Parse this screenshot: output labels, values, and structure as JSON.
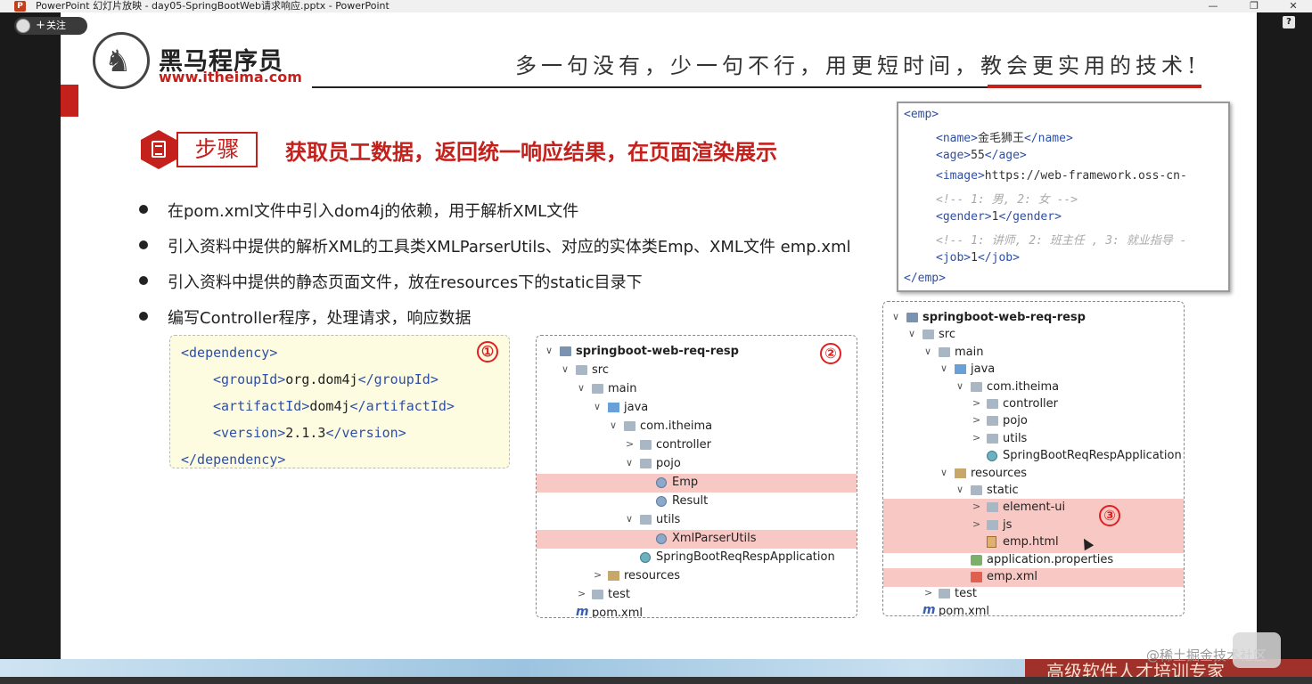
{
  "window": {
    "title": "PowerPoint 幻灯片放映  -  day05-SpringBootWeb请求响应.pptx - PowerPoint",
    "app_icon": "P",
    "min": "—",
    "restore": "❐",
    "close": "✕"
  },
  "follow": {
    "plus": "+",
    "label": "关注"
  },
  "help_icon": "?",
  "header": {
    "brand": "黑马程序员",
    "url": "www.itheima.com",
    "slogan": "多一句没有，少一句不行，用更短时间，教会更实用的技术!"
  },
  "step": {
    "label": "步骤",
    "heading": "获取员工数据，返回统一响应结果，在页面渲染展示"
  },
  "bullets": [
    "在pom.xml文件中引入dom4j的依赖，用于解析XML文件",
    "引入资料中提供的解析XML的工具类XMLParserUtils、对应的实体类Emp、XML文件 emp.xml",
    "引入资料中提供的静态页面文件，放在resources下的static目录下",
    "编写Controller程序，处理请求，响应数据"
  ],
  "emp_xml": {
    "open": "<emp>",
    "name_open": "<name>",
    "name_val": "金毛狮王",
    "name_close": "</name>",
    "age_open": "<age>",
    "age_val": "55",
    "age_close": "</age>",
    "image_open": "<image>",
    "image_val": "https://web-framework.oss-cn-",
    "comment1": "<!-- 1: 男, 2: 女 -->",
    "gender_open": "<gender>",
    "gender_val": "1",
    "gender_close": "</gender>",
    "comment2": "<!-- 1: 讲师, 2: 班主任 , 3: 就业指导 -",
    "job_open": "<job>",
    "job_val": "1",
    "job_close": "</job>",
    "close": "</emp>"
  },
  "dependency": {
    "num": "①",
    "open": "<dependency>",
    "group_open": "<groupId>",
    "group_val": "org.dom4j",
    "group_close": "</groupId>",
    "artifact_open": "<artifactId>",
    "artifact_val": "dom4j",
    "artifact_close": "</artifactId>",
    "version_open": "<version>",
    "version_val": "2.1.3",
    "version_close": "</version>",
    "close": "</dependency>"
  },
  "tree2": {
    "num": "②",
    "rows": [
      {
        "label": "springboot-web-req-resp",
        "arrow": "∨"
      },
      {
        "label": "src",
        "arrow": "∨"
      },
      {
        "label": "main",
        "arrow": "∨"
      },
      {
        "label": "java",
        "arrow": "∨"
      },
      {
        "label": "com.itheima",
        "arrow": "∨"
      },
      {
        "label": "controller",
        "arrow": ">"
      },
      {
        "label": "pojo",
        "arrow": "∨"
      },
      {
        "label": "Emp",
        "arrow": ""
      },
      {
        "label": "Result",
        "arrow": ""
      },
      {
        "label": "utils",
        "arrow": "∨"
      },
      {
        "label": "XmlParserUtils",
        "arrow": ""
      },
      {
        "label": "SpringBootReqRespApplication",
        "arrow": ""
      },
      {
        "label": "resources",
        "arrow": ">"
      },
      {
        "label": "test",
        "arrow": ">"
      },
      {
        "label": "pom.xml",
        "arrow": ""
      }
    ]
  },
  "tree3": {
    "num": "③",
    "rows": [
      {
        "label": "springboot-web-req-resp",
        "arrow": "∨"
      },
      {
        "label": "src",
        "arrow": "∨"
      },
      {
        "label": "main",
        "arrow": "∨"
      },
      {
        "label": "java",
        "arrow": "∨"
      },
      {
        "label": "com.itheima",
        "arrow": "∨"
      },
      {
        "label": "controller",
        "arrow": ">"
      },
      {
        "label": "pojo",
        "arrow": ">"
      },
      {
        "label": "utils",
        "arrow": ">"
      },
      {
        "label": "SpringBootReqRespApplication",
        "arrow": ""
      },
      {
        "label": "resources",
        "arrow": "∨"
      },
      {
        "label": "static",
        "arrow": "∨"
      },
      {
        "label": "element-ui",
        "arrow": ">"
      },
      {
        "label": "js",
        "arrow": ">"
      },
      {
        "label": "emp.html",
        "arrow": ""
      },
      {
        "label": "application.properties",
        "arrow": ""
      },
      {
        "label": "emp.xml",
        "arrow": ""
      },
      {
        "label": "test",
        "arrow": ">"
      },
      {
        "label": "pom.xml",
        "arrow": ""
      }
    ]
  },
  "watermark": "@稀土掘金技术社区",
  "bottom_banner": "高级软件人才培训专家",
  "colors": {
    "accent": "#c4201c",
    "xml_tag": "#2d4fa8",
    "highlight": "#f8c8c4",
    "code_bg": "#fdfbe0"
  }
}
